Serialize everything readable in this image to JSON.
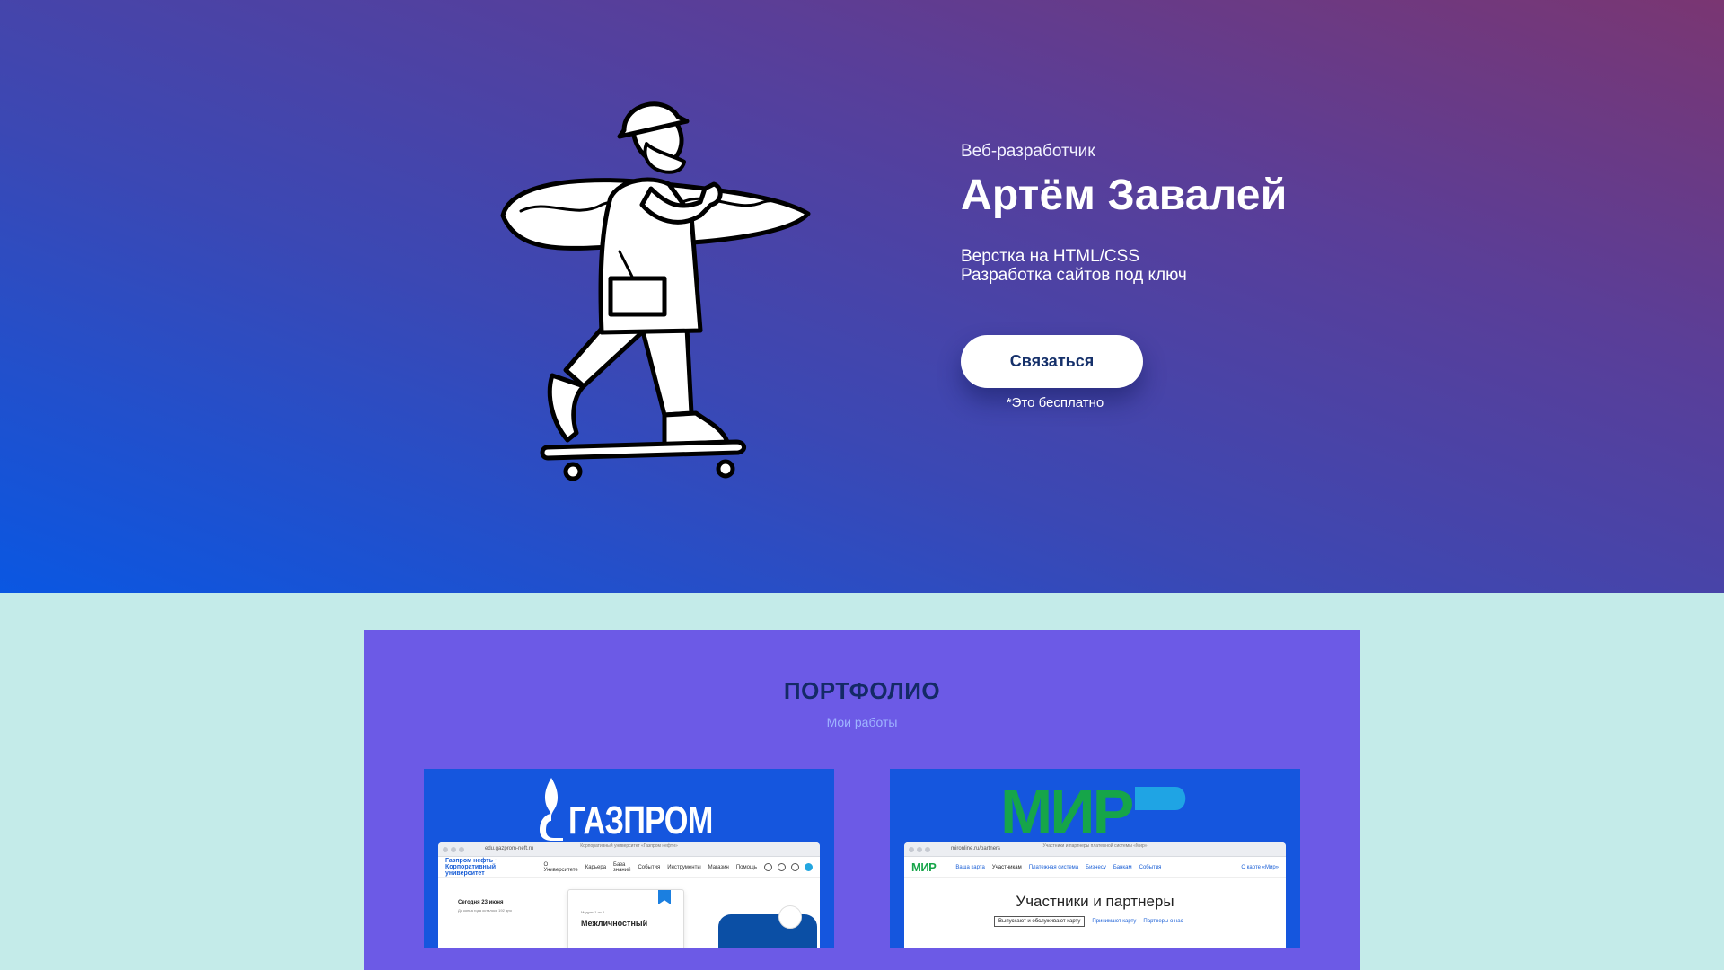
{
  "hero": {
    "role": "Веб-разработчик",
    "name": "Артём Завалей",
    "services": [
      "Верстка на HTML/CSS",
      "Разработка сайтов под ключ"
    ],
    "cta_label": "Связаться",
    "cta_note": "*Это бесплатно"
  },
  "portfolio": {
    "title": "ПОРТФОЛИО",
    "subtitle": "Мои работы",
    "projects": [
      {
        "logo_text": "ГАЗПРОМ",
        "browser_caption": "Корпоративный университет «Газпром нефти»",
        "browser_url": "edu.gazprom-neft.ru",
        "site_logo": "Газпром нефть · Корпоративный университет",
        "nav": [
          "О Университете",
          "Карьера",
          "База знаний",
          "События",
          "Инструменты",
          "Магазин",
          "Помощь"
        ],
        "date": "Сегодня 23 июня",
        "date_sub": "До конца года осталось 192 дня",
        "module_label": "Модуль 1 из 8",
        "module_title": "Межличностный"
      },
      {
        "logo_text": "МИР",
        "browser_caption": "Участники и партнеры платежной системы «Мир»",
        "browser_url": "mironline.ru/partners",
        "site_logo": "МИР",
        "nav": [
          "Ваша карта",
          "Участникам",
          "Платежная система",
          "Бизнесу",
          "Банкам",
          "События"
        ],
        "nav_right": "О карте «Мир»",
        "heading": "Участники и партнеры",
        "chip": "Выпускают и обслуживают карту",
        "links": [
          "Принимают карту",
          "Партнеры о нас"
        ]
      }
    ]
  },
  "colors": {
    "hero_gradient": [
      "#7a3672",
      "#5a3e98",
      "#3b48b4",
      "#0a57e2"
    ],
    "page_bg": "#c4ebe9",
    "portfolio_bg": "#6c5ae6",
    "card_bg": "#1556de",
    "title_dark": "#142a66",
    "mir_green": "#16a549",
    "mir_blue": "#1fa4e4"
  },
  "icons": [
    "skater-illustration",
    "gazprom-flame-icon",
    "search-icon",
    "notification-icon",
    "bookmark-icon"
  ]
}
